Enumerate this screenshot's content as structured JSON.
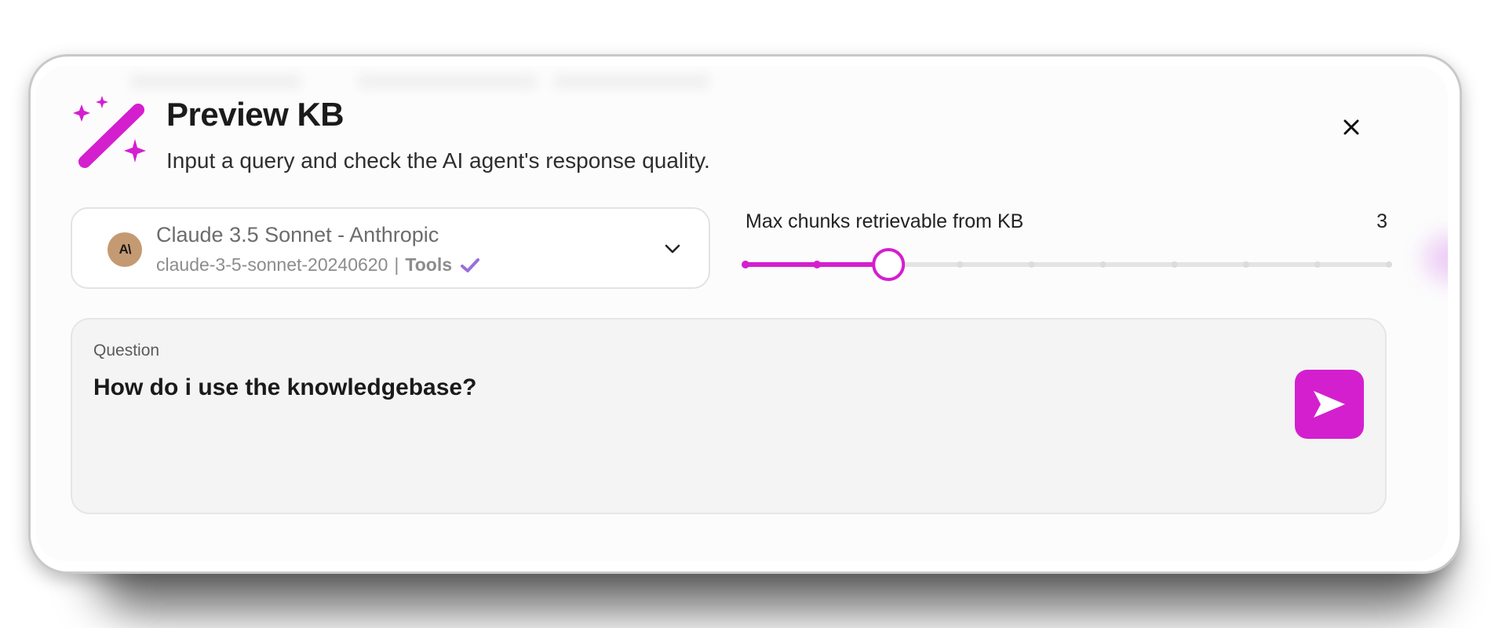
{
  "dialog": {
    "title": "Preview KB",
    "subtitle": "Input a query and check the AI agent's response quality."
  },
  "model": {
    "avatar_text": "A\\",
    "name": "Claude 3.5 Sonnet - Anthropic",
    "id": "claude-3-5-sonnet-20240620",
    "separator": "|",
    "capability": "Tools"
  },
  "slider": {
    "label": "Max chunks retrievable from KB",
    "value": "3",
    "min": 1,
    "max": 10,
    "current": 3
  },
  "question": {
    "label": "Question",
    "value": "How do i use the knowledgebase?"
  },
  "colors": {
    "accent": "#d41fcf",
    "check": "#9a6fd9",
    "track": "#e4e4e4"
  },
  "icons": {
    "header": "magic-wand-icon",
    "close": "close-icon",
    "dropdown": "chevron-down-icon",
    "capability": "check-icon",
    "send": "send-icon"
  }
}
